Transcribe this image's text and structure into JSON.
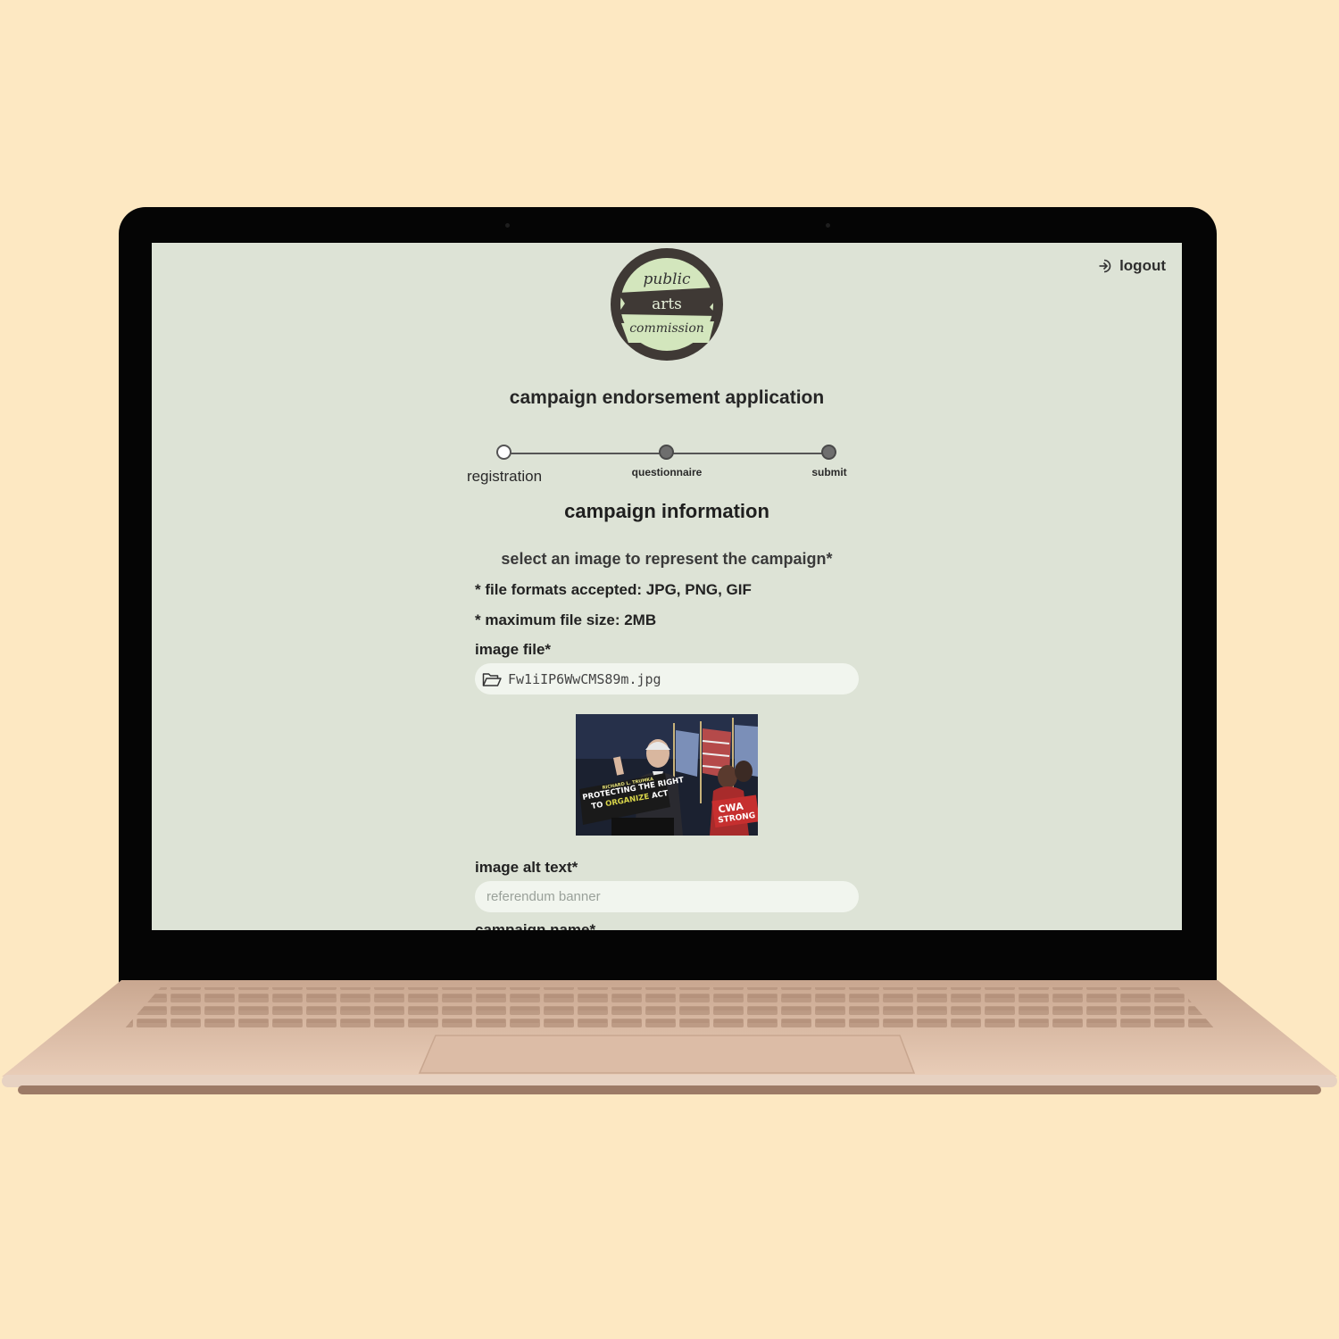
{
  "header": {
    "logout_label": "logout",
    "logo": {
      "line1": "public",
      "line2": "arts",
      "line3": "commission"
    },
    "app_title": "campaign endorsement application"
  },
  "stepper": {
    "steps": [
      {
        "label": "registration",
        "state": "current"
      },
      {
        "label": "questionnaire",
        "state": "upcoming"
      },
      {
        "label": "submit",
        "state": "upcoming"
      }
    ]
  },
  "form": {
    "section_title": "campaign information",
    "image_prompt": "select an image to represent the campaign*",
    "note_formats": "* file formats accepted: JPG, PNG, GIF",
    "note_size": "* maximum file size: 2MB",
    "image_file_label": "image file*",
    "image_file_name": "Fw1iIP6WwCMS89m.jpg",
    "preview": {
      "banner_line1": "RICHARD L. TRUMKA",
      "banner_line2": "PROTECTING THE RIGHT",
      "banner_line3a": "TO ",
      "banner_line3b": "ORGANIZE",
      "banner_line3c": " ACT",
      "sign_line1": "CWA",
      "sign_line2": "STRONG"
    },
    "alt_text_label": "image alt text*",
    "alt_text_placeholder": "referendum banner",
    "campaign_name_label": "campaign name*"
  },
  "colors": {
    "page_background": "#fde8c2",
    "screen_background": "#dde3d6",
    "input_background": "#f1f5ee",
    "logo_ring": "#3f3935",
    "logo_fill": "#d3e6bd"
  }
}
